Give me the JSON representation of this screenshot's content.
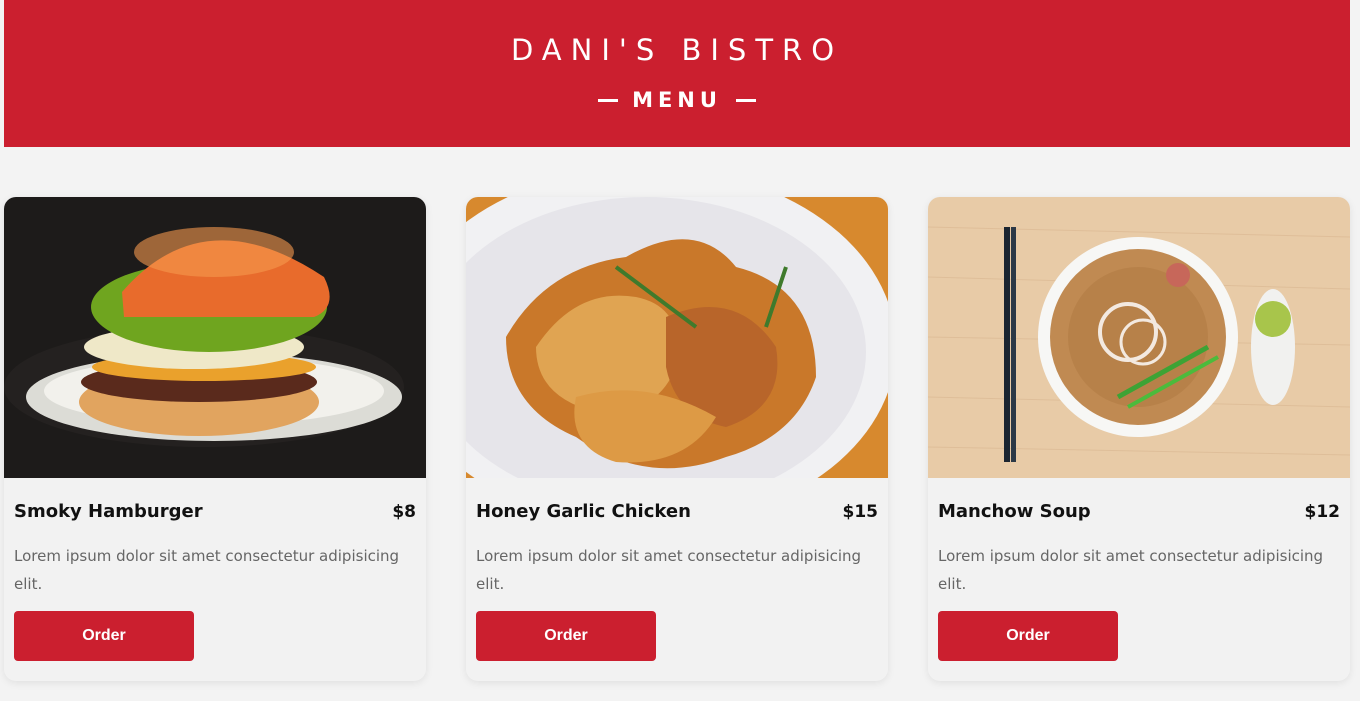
{
  "header": {
    "title": "DANI'S BISTRO",
    "subtitle": "MENU"
  },
  "colors": {
    "brand_red": "#cb1f2f",
    "background": "#f3f3f3"
  },
  "menu": {
    "items": [
      {
        "name": "Smoky Hamburger",
        "price": "$8",
        "description": "Lorem ipsum dolor sit amet consectetur adipisicing elit.",
        "button": "Order",
        "image": "hamburger-photo"
      },
      {
        "name": "Honey Garlic Chicken",
        "price": "$15",
        "description": "Lorem ipsum dolor sit amet consectetur adipisicing elit.",
        "button": "Order",
        "image": "chicken-wings-photo"
      },
      {
        "name": "Manchow Soup",
        "price": "$12",
        "description": "Lorem ipsum dolor sit amet consectetur adipisicing elit.",
        "button": "Order",
        "image": "noodle-soup-photo"
      }
    ]
  }
}
